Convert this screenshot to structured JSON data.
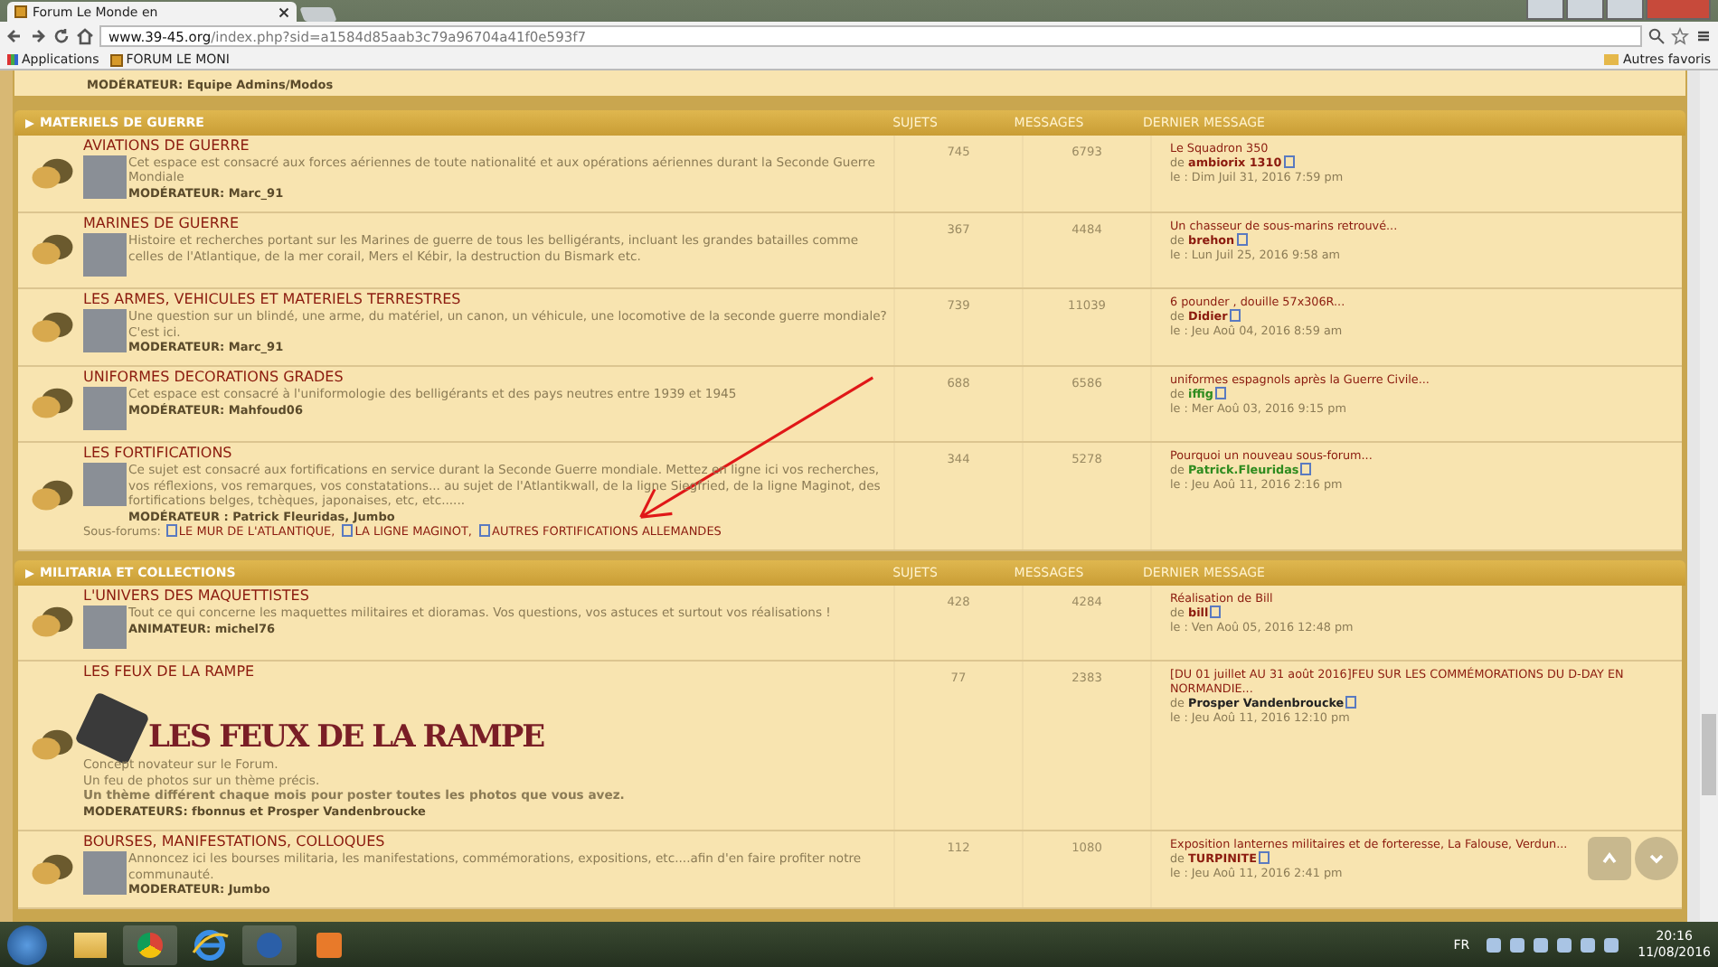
{
  "browser": {
    "tab_title": "Forum Le Monde en",
    "url_host": "www.39-45.org",
    "url_path": "/index.php?sid=a1584d85aab3c79a96704a41f0e593f7",
    "bookmarks": [
      "Applications",
      "FORUM LE MONI"
    ],
    "other_bookmarks": "Autres favoris"
  },
  "top_partial": {
    "moderator": "MODÉRATEUR: Equipe Admins/Modos"
  },
  "sections": [
    {
      "title": "MATERIELS DE GUERRE",
      "columns": [
        "SUJETS",
        "MESSAGES",
        "DERNIER MESSAGE"
      ],
      "forums": [
        {
          "title": "AVIATIONS DE GUERRE",
          "description": [
            "Cet espace est consacré aux forces aériennes de toute nationalité et aux opérations aériennes durant la Seconde Guerre Mondiale"
          ],
          "moderator": "MODÉRATEUR: Marc_91",
          "topics": "745",
          "posts": "6793",
          "last": {
            "title": "Le Squadron 350",
            "by": "de",
            "author": "ambiorix 1310",
            "color": "#8b1a0e",
            "date": "le : Dim Juil 31, 2016 7:59 pm"
          }
        },
        {
          "title": "MARINES DE GUERRE",
          "description": [
            "Histoire et recherches portant sur les Marines de guerre de tous les belligérants, incluant les grandes batailles comme celles de l'Atlantique, de la mer corail, Mers el Kébir, la destruction du Bismark etc."
          ],
          "topics": "367",
          "posts": "4484",
          "last": {
            "title": "Un chasseur de sous-marins retrouvé...",
            "by": "de",
            "author": "brehon",
            "color": "#8b1a0e",
            "date": "le : Lun Juil 25, 2016 9:58 am"
          }
        },
        {
          "title": "LES ARMES, VEHICULES ET MATERIELS TERRESTRES",
          "description": [
            "Une question sur un blindé, une arme, du matériel, un canon, un véhicule, une locomotive de la seconde guerre mondiale?",
            "C'est ici."
          ],
          "moderator": "MODERATEUR: Marc_91",
          "topics": "739",
          "posts": "11039",
          "last": {
            "title": "6 pounder , douille 57x306R...",
            "by": "de",
            "author": "Didier",
            "color": "#8b1a0e",
            "date": "le : Jeu Aoû 04, 2016 8:59 am"
          }
        },
        {
          "title": "UNIFORMES DECORATIONS GRADES",
          "description": [
            "Cet espace est consacré à l'uniformologie des belligérants et des pays neutres entre 1939 et 1945"
          ],
          "moderator": "MODÉRATEUR: Mahfoud06",
          "topics": "688",
          "posts": "6586",
          "last": {
            "title": "uniformes espagnols après la Guerre Civile...",
            "by": "de",
            "author": "iffig",
            "color": "#2e8b1e",
            "date": "le : Mer Aoû 03, 2016 9:15 pm"
          }
        },
        {
          "title": "LES FORTIFICATIONS",
          "description": [
            "Ce sujet est consacré aux fortifications en service durant la Seconde Guerre mondiale. Mettez en ligne ici vos recherches, vos réflexions, vos remarques, vos constatations... au sujet de l'Atlantikwall, de la ligne Siegfried, de la ligne Maginot, des fortifications belges, tchèques, japonaises, etc, etc......"
          ],
          "moderator": "MODÉRATEUR : Patrick Fleuridas, Jumbo",
          "subforums_label": "Sous-forums:",
          "subforums": [
            "LE MUR DE L'ATLANTIQUE,",
            "LA LIGNE MAGINOT,",
            "AUTRES FORTIFICATIONS ALLEMANDES"
          ],
          "topics": "344",
          "posts": "5278",
          "last": {
            "title": "Pourquoi un nouveau sous-forum...",
            "by": "de",
            "author": "Patrick.Fleuridas",
            "color": "#2e8b1e",
            "date": "le : Jeu Aoû 11, 2016 2:16 pm"
          }
        }
      ]
    },
    {
      "title": "MILITARIA ET COLLECTIONS",
      "columns": [
        "SUJETS",
        "MESSAGES",
        "DERNIER MESSAGE"
      ],
      "forums": [
        {
          "title": "L'UNIVERS DES MAQUETTISTES",
          "description": [
            "Tout ce qui concerne les maquettes militaires et dioramas. Vos questions, vos astuces et surtout vos réalisations !"
          ],
          "moderator": "ANIMATEUR: michel76",
          "topics": "428",
          "posts": "4284",
          "last": {
            "title": "Réalisation de Bill",
            "by": "de",
            "author": "bill",
            "color": "#8b1a0e",
            "date": "le : Ven Aoû 05, 2016 12:48 pm"
          }
        },
        {
          "title": "LES FEUX DE LA RAMPE",
          "banner": "LES FEUX DE LA RAMPE",
          "description": [
            "Concept novateur sur le Forum.",
            "Un feu de photos sur un thème précis.",
            "**Un thème différent chaque mois pour poster toutes les photos que vous avez.**"
          ],
          "moderator": "MODERATEURS: fbonnus et Prosper Vandenbroucke",
          "topics": "77",
          "posts": "2383",
          "last": {
            "title": "[DU 01 juillet AU 31 août 2016]FEU SUR LES COMMÉMORATIONS DU D-DAY EN NORMANDIE...",
            "by": "de",
            "author": "Prosper Vandenbroucke",
            "color": "#222222",
            "date": "le : Jeu Aoû 11, 2016 12:10 pm"
          }
        },
        {
          "title": "BOURSES, MANIFESTATIONS, COLLOQUES",
          "description": [
            "Annoncez ici les bourses militaria, les manifestations, commémorations, expositions, etc....afin d'en faire profiter notre communauté."
          ],
          "moderator": "MODERATEUR: Jumbo",
          "topics": "112",
          "posts": "1080",
          "last": {
            "title": "Exposition lanternes militaires et de forteresse, La Falouse, Verdun...",
            "by": "de",
            "author": "TURPINITE",
            "color": "#8b1a0e",
            "date": "le : Jeu Aoû 11, 2016 2:41 pm"
          }
        }
      ]
    }
  ],
  "taskbar": {
    "language": "FR",
    "time": "20:16",
    "date": "11/08/2016"
  }
}
